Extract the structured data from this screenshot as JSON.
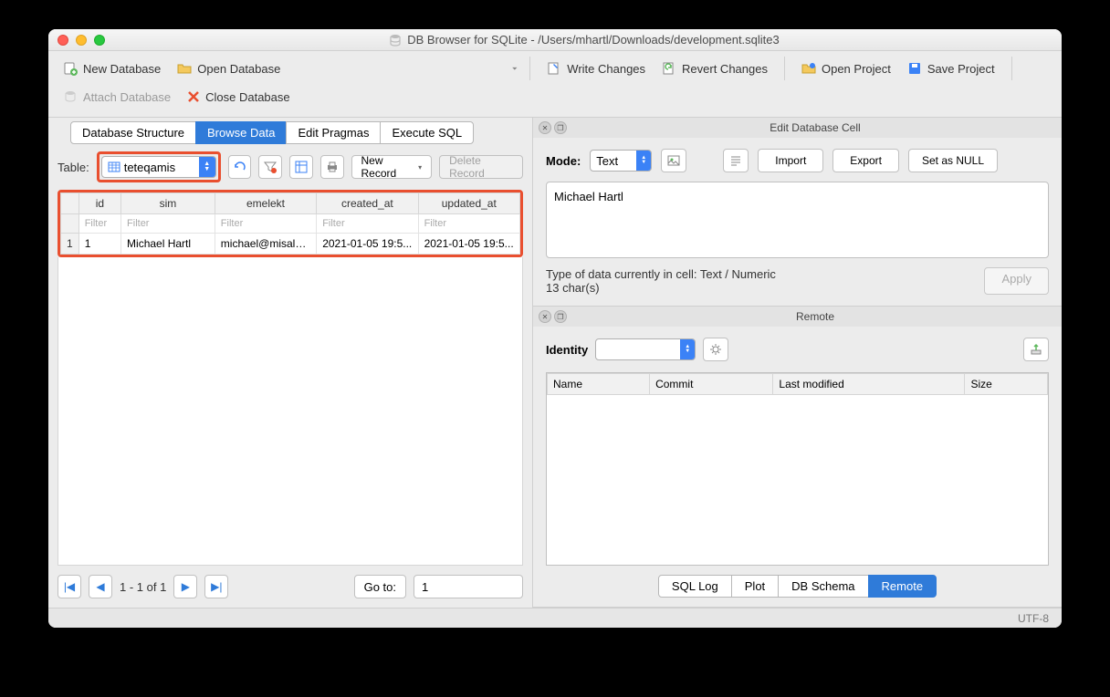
{
  "window_title": "DB Browser for SQLite - /Users/mhartl/Downloads/development.sqlite3",
  "toolbar": {
    "new_db": "New Database",
    "open_db": "Open Database",
    "write_changes": "Write Changes",
    "revert_changes": "Revert Changes",
    "open_project": "Open Project",
    "save_project": "Save Project",
    "attach_db": "Attach Database",
    "close_db": "Close Database"
  },
  "main_tabs": [
    "Database Structure",
    "Browse Data",
    "Edit Pragmas",
    "Execute SQL"
  ],
  "main_tab_active": 1,
  "table_label": "Table:",
  "selected_table": "teteqamis",
  "new_record": "New Record",
  "delete_record": "Delete Record",
  "columns": [
    "id",
    "sim",
    "emelekt",
    "created_at",
    "updated_at"
  ],
  "filter_placeholder": "Filter",
  "rows": [
    {
      "n": "1",
      "id": "1",
      "sim": "Michael Hartl",
      "emelekt": "michael@misalei...",
      "created_at": "2021-01-05 19:5...",
      "updated_at": "2021-01-05 19:5..."
    }
  ],
  "pager_label": "1 - 1 of 1",
  "goto_label": "Go to:",
  "goto_value": "1",
  "edit_cell": {
    "title": "Edit Database Cell",
    "mode_label": "Mode:",
    "mode_value": "Text",
    "import": "Import",
    "export": "Export",
    "set_null": "Set as NULL",
    "value": "Michael Hartl",
    "type_line": "Type of data currently in cell: Text / Numeric",
    "chars": "13 char(s)",
    "apply": "Apply"
  },
  "remote": {
    "title": "Remote",
    "identity_label": "Identity",
    "cols": [
      "Name",
      "Commit",
      "Last modified",
      "Size"
    ]
  },
  "bottom_tabs": [
    "SQL Log",
    "Plot",
    "DB Schema",
    "Remote"
  ],
  "bottom_active": 3,
  "status": "UTF-8"
}
